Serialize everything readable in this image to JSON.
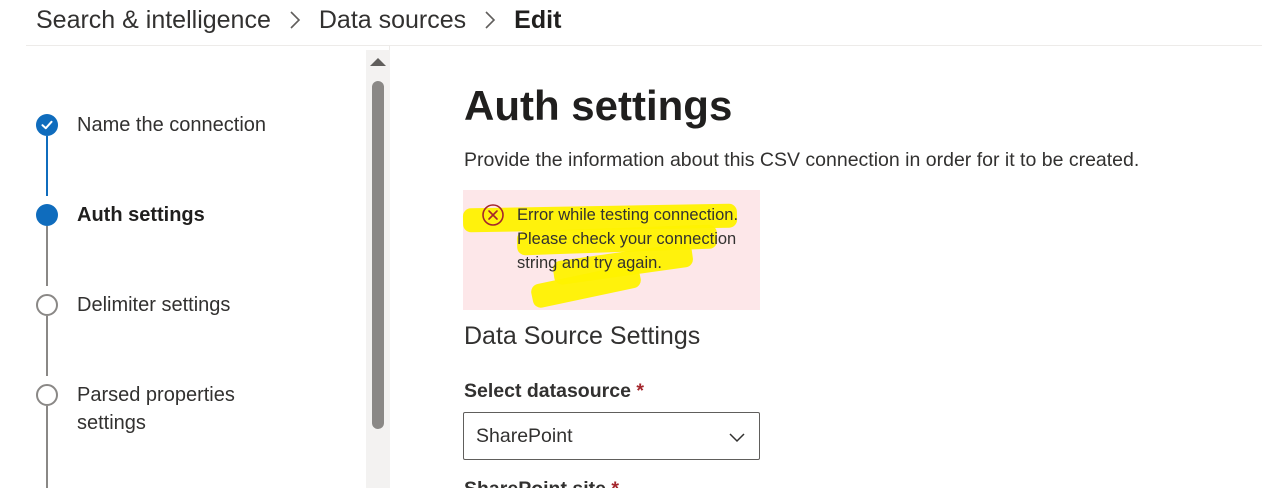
{
  "breadcrumb": {
    "items": [
      "Search & intelligence",
      "Data sources"
    ],
    "current": "Edit"
  },
  "wizard": {
    "steps": [
      {
        "label": "Name the connection",
        "state": "completed"
      },
      {
        "label": "Auth settings",
        "state": "current"
      },
      {
        "label": "Delimiter settings",
        "state": "pending"
      },
      {
        "label": "Parsed properties settings",
        "state": "pending"
      }
    ]
  },
  "main": {
    "title": "Auth settings",
    "description": "Provide the information about this CSV connection in order for it to be created.",
    "error": {
      "message": "Error while testing connection. Please check your connection string and try again.",
      "icon": "error-circle-icon"
    },
    "section_heading": "Data Source Settings",
    "select_datasource": {
      "label": "Select datasource",
      "required_marker": "*",
      "value": "SharePoint"
    },
    "next_field": {
      "label": "SharePoint site",
      "required_marker": "*"
    }
  },
  "colors": {
    "accent": "#0f6cbd",
    "error_background": "#fde7e9",
    "error_icon": "#a4262c",
    "highlight": "#fff200"
  }
}
